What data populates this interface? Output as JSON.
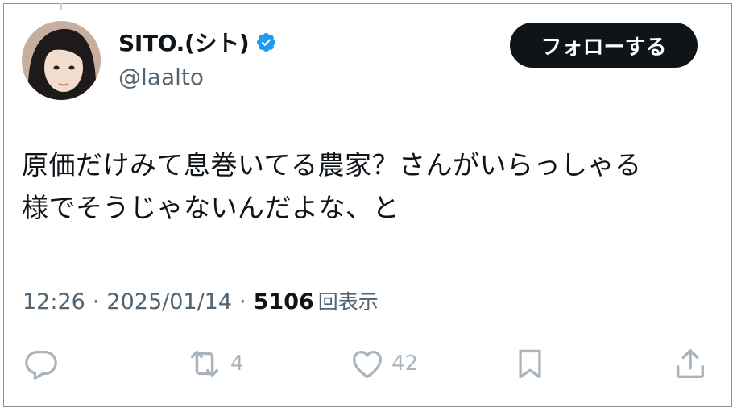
{
  "author": {
    "display_name": "SITO.(シト)",
    "handle": "@laalto",
    "verified": true,
    "verified_icon": "verified-badge-icon",
    "verified_color": "#1d9bf0"
  },
  "follow_button": {
    "label": "フォローする"
  },
  "tweet": {
    "lines": [
      "原価だけみて息巻いてる農家？さんがいらっしゃる",
      "様でそうじゃないんだよな、と"
    ]
  },
  "meta": {
    "time": "12:26",
    "separator": "·",
    "date": "2025/01/14",
    "views": "5106",
    "views_label": "回表示"
  },
  "actions": {
    "reply": {
      "icon": "reply-icon"
    },
    "retweet": {
      "icon": "retweet-icon",
      "count": "4"
    },
    "like": {
      "icon": "heart-icon",
      "count": "42"
    },
    "bookmark": {
      "icon": "bookmark-icon"
    },
    "share": {
      "icon": "share-icon"
    }
  },
  "colors": {
    "text": "#0f1419",
    "muted": "#536471",
    "action_icon": "#a9b4bd",
    "button_bg": "#0f1419"
  }
}
